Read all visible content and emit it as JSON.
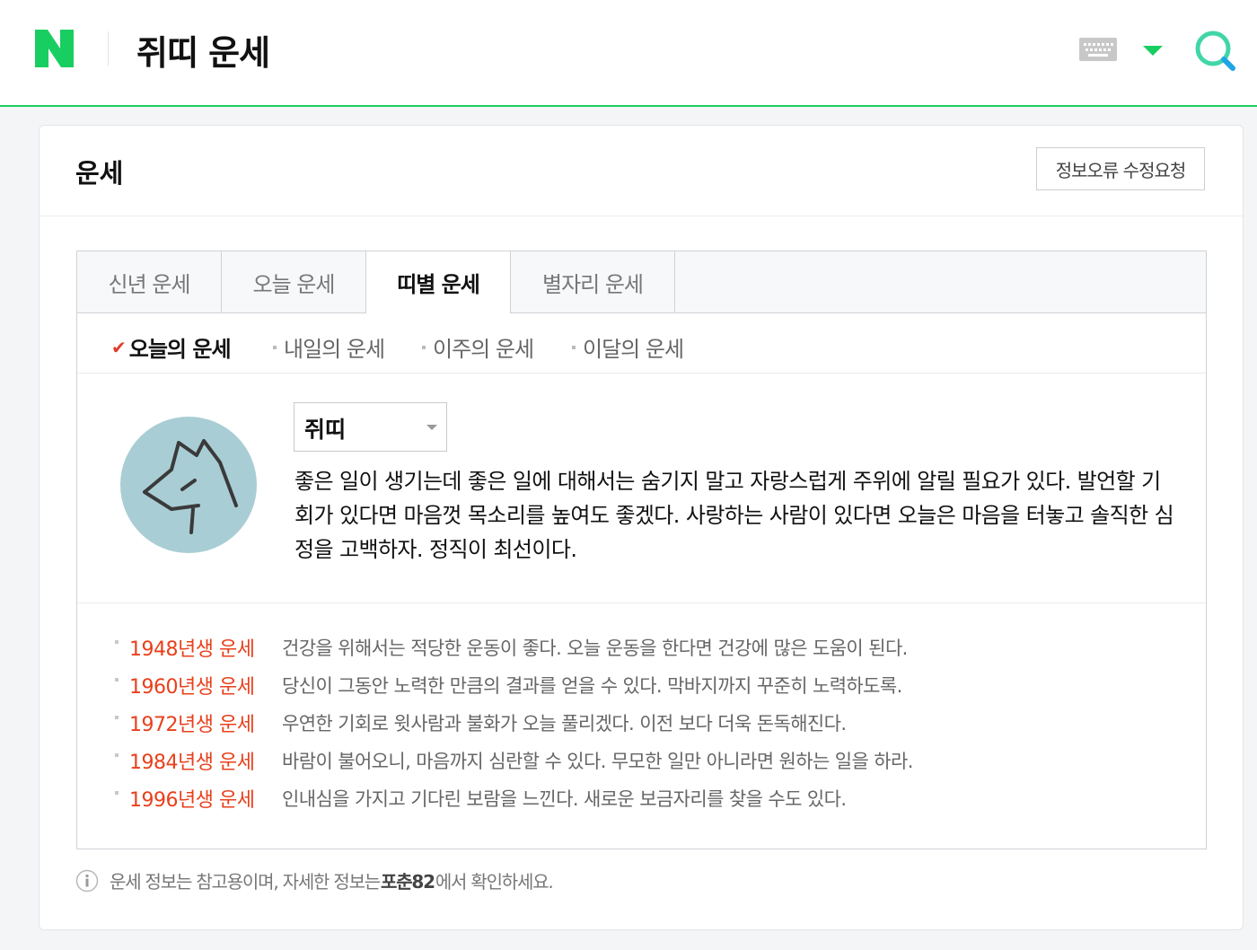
{
  "header": {
    "query": "쥐띠 운세",
    "brand_color": "#19ce60"
  },
  "card": {
    "title": "운세",
    "report_button": "정보오류 수정요청"
  },
  "tabs": [
    {
      "label": "신년 운세",
      "active": false
    },
    {
      "label": "오늘 운세",
      "active": false
    },
    {
      "label": "띠별 운세",
      "active": true
    },
    {
      "label": "별자리 운세",
      "active": false
    }
  ],
  "subtabs": [
    {
      "label": "오늘의 운세",
      "active": true
    },
    {
      "label": "내일의 운세",
      "active": false
    },
    {
      "label": "이주의 운세",
      "active": false
    },
    {
      "label": "이달의 운세",
      "active": false
    }
  ],
  "zodiac_select": {
    "value": "쥐띠"
  },
  "fortune": {
    "text": "좋은 일이 생기는데 좋은 일에 대해서는 숨기지 말고 자랑스럽게 주위에 알릴 필요가 있다. 발언할 기회가 있다면 마음껏 목소리를 높여도 좋겠다. 사랑하는 사람이 있다면 오늘은 마음을 터놓고 솔직한 심정을 고백하자. 정직이 최선이다."
  },
  "years": [
    {
      "label": "1948년생 운세",
      "desc": "건강을 위해서는 적당한 운동이 좋다. 오늘 운동을 한다면 건강에 많은 도움이 된다."
    },
    {
      "label": "1960년생 운세",
      "desc": "당신이 그동안 노력한 만큼의 결과를 얻을 수 있다. 막바지까지 꾸준히 노력하도록."
    },
    {
      "label": "1972년생 운세",
      "desc": "우연한 기회로 윗사람과 불화가 오늘 풀리겠다. 이전 보다 더욱 돈독해진다."
    },
    {
      "label": "1984년생 운세",
      "desc": "바람이 불어오니, 마음까지 심란할 수 있다. 무모한 일만 아니라면 원하는 일을 하라."
    },
    {
      "label": "1996년생 운세",
      "desc": "인내심을 가지고 기다린 보람을 느낀다. 새로운 보금자리를 찾을 수도 있다."
    }
  ],
  "note": {
    "prefix": "운세 정보는 참고용이며, 자세한 정보는 ",
    "source": "포춘82",
    "suffix": "에서 확인하세요."
  },
  "icons": {
    "logo": "naver-logo",
    "keyboard": "keyboard-icon",
    "dropdown": "caret-down-icon",
    "search": "search-icon",
    "check": "check-icon",
    "info": "info-icon",
    "avatar": "rat-icon"
  }
}
